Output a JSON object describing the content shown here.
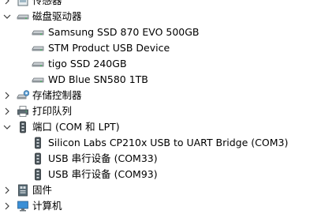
{
  "tree": {
    "categories": [
      {
        "label": "传感器",
        "expanded": false,
        "icon": "sensor-icon"
      },
      {
        "label": "磁盘驱动器",
        "expanded": true,
        "icon": "disk-drive-icon",
        "children": [
          {
            "label": "Samsung SSD 870 EVO 500GB",
            "icon": "disk-drive-icon"
          },
          {
            "label": "STM Product USB Device",
            "icon": "disk-drive-icon"
          },
          {
            "label": "tigo SSD 240GB",
            "icon": "disk-drive-icon"
          },
          {
            "label": "WD Blue SN580 1TB",
            "icon": "disk-drive-icon"
          }
        ]
      },
      {
        "label": "存储控制器",
        "expanded": false,
        "icon": "storage-controller-icon"
      },
      {
        "label": "打印队列",
        "expanded": false,
        "icon": "printer-icon"
      },
      {
        "label": "端口 (COM 和 LPT)",
        "expanded": true,
        "icon": "port-icon",
        "children": [
          {
            "label": "Silicon Labs CP210x USB to UART Bridge (COM3)",
            "icon": "port-icon"
          },
          {
            "label": "USB 串行设备 (COM33)",
            "icon": "port-icon"
          },
          {
            "label": "USB 串行设备 (COM93)",
            "icon": "port-icon"
          }
        ]
      },
      {
        "label": "固件",
        "expanded": false,
        "icon": "firmware-icon"
      },
      {
        "label": "计算机",
        "expanded": false,
        "icon": "computer-icon"
      }
    ]
  }
}
